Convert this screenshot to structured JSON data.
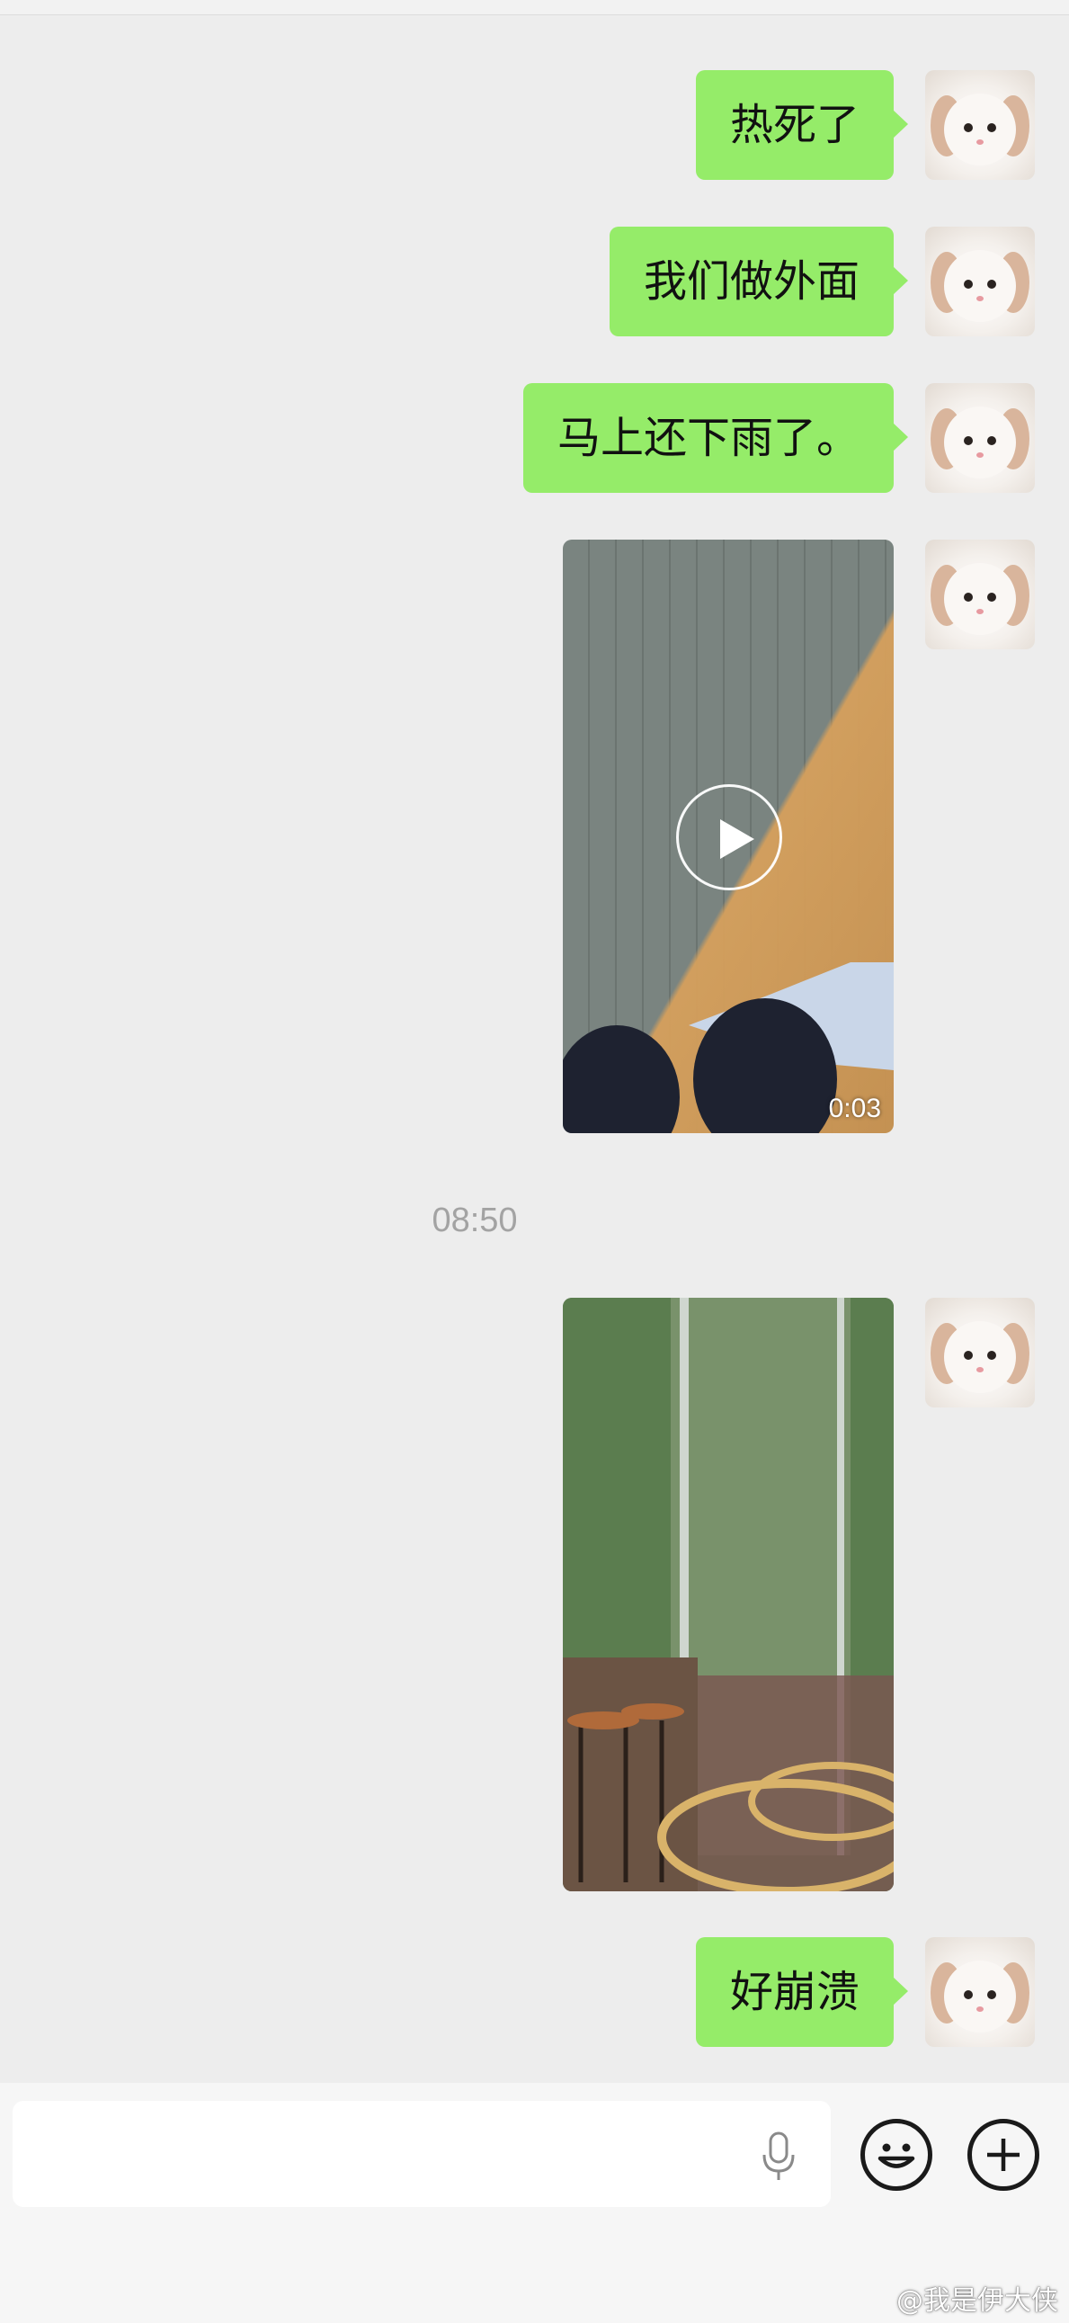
{
  "chat": {
    "messages": [
      {
        "type": "text",
        "text": "热死了"
      },
      {
        "type": "text",
        "text": "我们做外面"
      },
      {
        "type": "text",
        "text": "马上还下雨了。"
      },
      {
        "type": "video",
        "duration": "0:03"
      },
      {
        "type": "image"
      },
      {
        "type": "text",
        "text": "好崩溃"
      }
    ],
    "timestamp": "08:50"
  },
  "colors": {
    "background": "#ededed",
    "bubble": "#95ec69",
    "input_bar": "#f6f6f6"
  },
  "icons": {
    "voice": "microphone-icon",
    "emoji": "smiley-icon",
    "more": "plus-circle-icon"
  },
  "watermark": "@我是伊大侠"
}
